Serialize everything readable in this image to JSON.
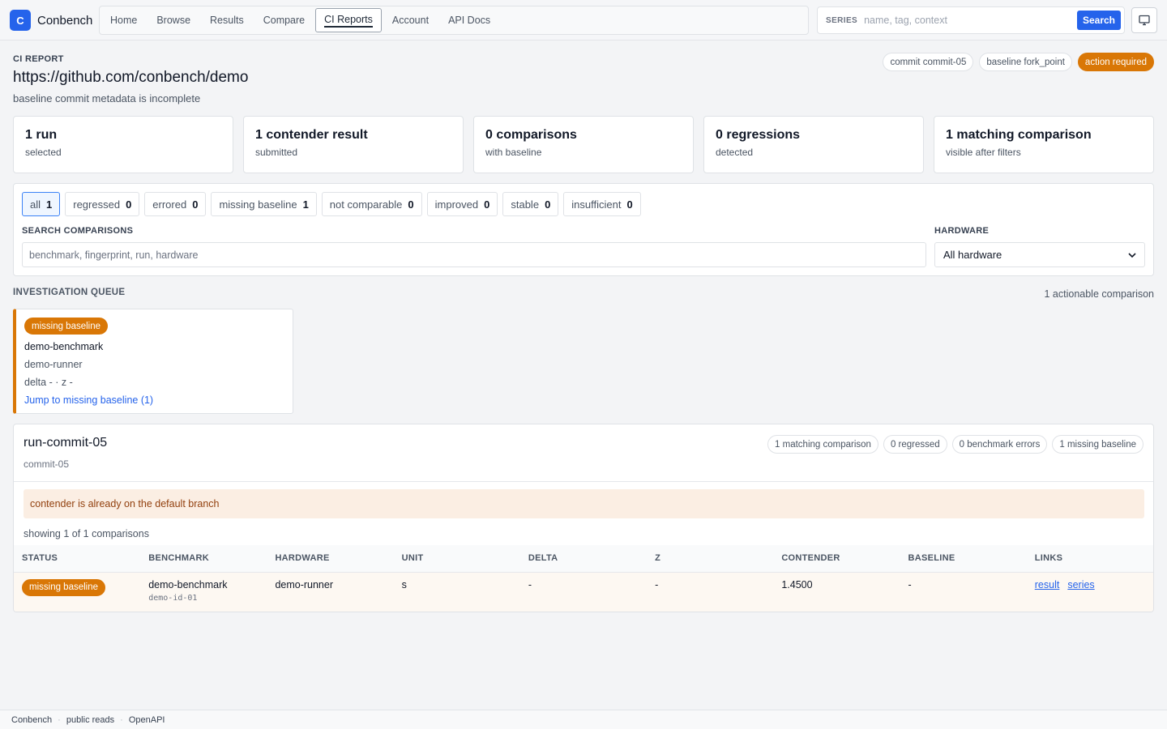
{
  "brand": {
    "logo_letter": "C",
    "name": "Conbench",
    "accent": "#2563eb"
  },
  "nav": {
    "items": [
      {
        "label": "Home"
      },
      {
        "label": "Browse"
      },
      {
        "label": "Results"
      },
      {
        "label": "Compare"
      },
      {
        "label": "CI Reports",
        "active": true
      },
      {
        "label": "Account"
      },
      {
        "label": "API Docs"
      }
    ]
  },
  "series_search": {
    "label": "SERIES",
    "placeholder": "name, tag, context",
    "button": "Search"
  },
  "header": {
    "eyebrow": "CI REPORT",
    "title": "https://github.com/conbench/demo",
    "subtitle": "baseline commit metadata is incomplete",
    "badges": [
      "commit commit-05",
      "baseline fork_point",
      "action required"
    ],
    "warning_color": "#d97706"
  },
  "stats": [
    {
      "value": "1 run",
      "label": "selected"
    },
    {
      "value": "1 contender result",
      "label": "submitted"
    },
    {
      "value": "0 comparisons",
      "label": "with baseline"
    },
    {
      "value": "0 regressions",
      "label": "detected"
    },
    {
      "value": "1 matching comparison",
      "label": "visible after filters"
    }
  ],
  "filters": {
    "chips": [
      {
        "label": "all",
        "count": "1"
      },
      {
        "label": "regressed",
        "count": "0"
      },
      {
        "label": "errored",
        "count": "0"
      },
      {
        "label": "missing baseline",
        "count": "1"
      },
      {
        "label": "not comparable",
        "count": "0"
      },
      {
        "label": "improved",
        "count": "0"
      },
      {
        "label": "stable",
        "count": "0"
      },
      {
        "label": "insufficient",
        "count": "0"
      }
    ],
    "search_label": "SEARCH COMPARISONS",
    "search_placeholder": "benchmark, fingerprint, run, hardware",
    "hardware_label": "HARDWARE",
    "hardware_value": "All hardware"
  },
  "queue": {
    "title": "INVESTIGATION QUEUE",
    "count": "1 actionable comparison",
    "card": {
      "badge": "missing baseline",
      "benchmark": "demo-benchmark",
      "hardware": "demo-runner",
      "metrics": "delta - · z -",
      "link": "Jump to missing baseline (1)"
    }
  },
  "run": {
    "title": "run-commit-05",
    "subtitle": "commit-05",
    "pills": [
      "1 matching comparison",
      "0 regressed",
      "0 benchmark errors",
      "1 missing baseline"
    ],
    "notice": "contender is already on the default branch",
    "showing": "showing 1 of 1 comparisons",
    "columns": [
      "STATUS",
      "BENCHMARK",
      "HARDWARE",
      "UNIT",
      "DELTA",
      "Z",
      "CONTENDER",
      "BASELINE",
      "LINKS"
    ],
    "row": {
      "status": "missing baseline",
      "benchmark": "demo-benchmark",
      "benchmark_id": "demo-id-01",
      "hardware": "demo-runner",
      "unit": "s",
      "delta": "-",
      "z": "-",
      "contender": "1.4500",
      "baseline": "-",
      "link_result": "result",
      "link_series": "series"
    }
  },
  "footer": {
    "items": [
      "Conbench",
      "public reads",
      "OpenAPI"
    ]
  }
}
